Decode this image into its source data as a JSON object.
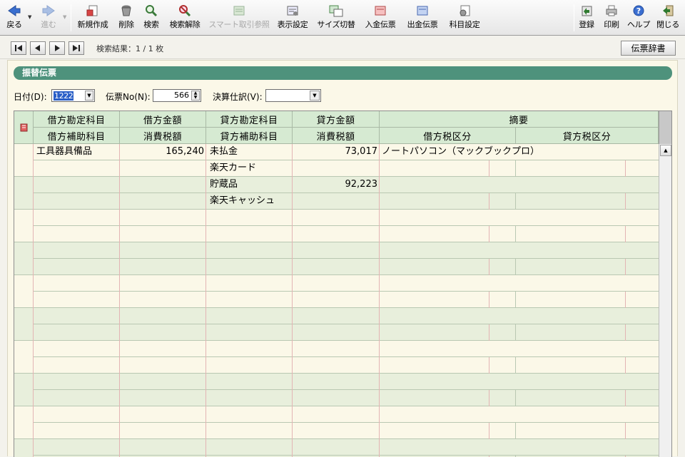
{
  "toolbar": {
    "back": "戻る",
    "forward": "進む",
    "new": "新規作成",
    "delete": "削除",
    "search": "検索",
    "search_clear": "検索解除",
    "smart": "スマート取引参照",
    "display_settings": "表示設定",
    "size_toggle": "サイズ切替",
    "deposit_slip": "入金伝票",
    "payment_slip": "出金伝票",
    "account_settings": "科目設定",
    "register": "登録",
    "print": "印刷",
    "help": "ヘルプ",
    "close": "閉じる"
  },
  "nav": {
    "result_text": "検索結果：1 / 1 枚",
    "dict_button": "伝票辞書"
  },
  "panel": {
    "title": "振替伝票"
  },
  "form": {
    "date_label": "日付(D):",
    "date_value": "1222",
    "no_label": "伝票No(N):",
    "no_value": "566",
    "kessan_label": "決算仕訳(V):",
    "kessan_value": ""
  },
  "grid": {
    "headers_top": [
      "借方勘定科目",
      "借方金額",
      "貸方勘定科目",
      "貸方金額",
      "摘要"
    ],
    "headers_bottom": [
      "借方補助科目",
      "消費税額",
      "貸方補助科目",
      "消費税額",
      "借方税区分",
      "貸方税区分"
    ],
    "entries": [
      {
        "debit_account": "工具器具備品",
        "debit_sub": "",
        "debit_amount": "165,240",
        "debit_tax": "",
        "credit_account": "未払金",
        "credit_sub": "楽天カード",
        "credit_amount": "73,017",
        "credit_tax": "",
        "memo": "ノートパソコン（マックブックプロ）"
      },
      {
        "debit_account": "",
        "debit_sub": "",
        "debit_amount": "",
        "debit_tax": "",
        "credit_account": "貯蔵品",
        "credit_sub": "楽天キャッシュ",
        "credit_amount": "92,223",
        "credit_tax": "",
        "memo": ""
      }
    ]
  },
  "colors": {
    "title_bar": "#4e927c",
    "header_bg": "#d6ead2",
    "row_band_a": "#fbf8e8",
    "row_band_b": "#e8efdc",
    "grid_line_red": "#e3b4b4",
    "grid_line_green": "#b9c8b2"
  }
}
